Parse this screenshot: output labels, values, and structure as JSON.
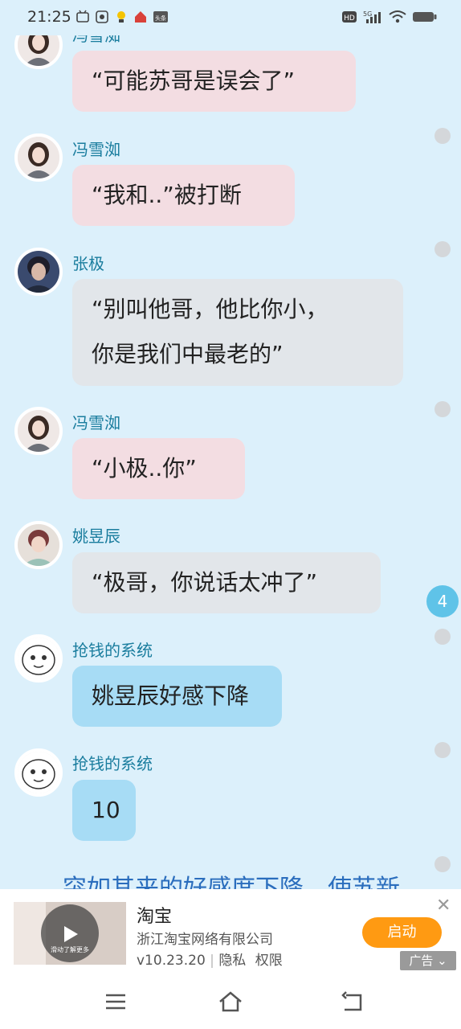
{
  "status": {
    "time": "21:25",
    "network": "5G",
    "hd": "HD"
  },
  "messages": [
    {
      "sender": "冯雪洳",
      "text": "“可能苏哥是误会了”",
      "style": "pink"
    },
    {
      "sender": "冯雪洳",
      "text": "“我和..”被打断",
      "style": "pink"
    },
    {
      "sender": "张极",
      "line1": "“别叫他哥，他比你小，",
      "line2": "你是我们中最老的”",
      "style": "gray"
    },
    {
      "sender": "冯雪洳",
      "text": "“小极..你”",
      "style": "pink"
    },
    {
      "sender": "姚昱辰",
      "text": "“极哥，你说话太冲了”",
      "style": "gray"
    },
    {
      "sender": "抢钱的系统",
      "text": "姚昱辰好感下降",
      "style": "blue"
    },
    {
      "sender": "抢钱的系统",
      "text": "10",
      "style": "blue"
    }
  ],
  "partial_text": "突如其来的好感度下降，使苏新",
  "unread_count": "4",
  "ad": {
    "title": "淘宝",
    "company": "浙江淘宝网络有限公司",
    "version": "v10.23.20",
    "privacy": "隐私",
    "permissions": "权限",
    "button": "启动",
    "tag": "广告",
    "close": "✕",
    "thumb_text": "滑动了解更多"
  },
  "colors": {
    "background": "#dcf0fb",
    "name": "#1a7d9e",
    "pink_bubble": "#f3dde2",
    "gray_bubble": "#e2e6ea",
    "blue_bubble": "#a7dcf5",
    "ad_button": "#ff9a12"
  }
}
